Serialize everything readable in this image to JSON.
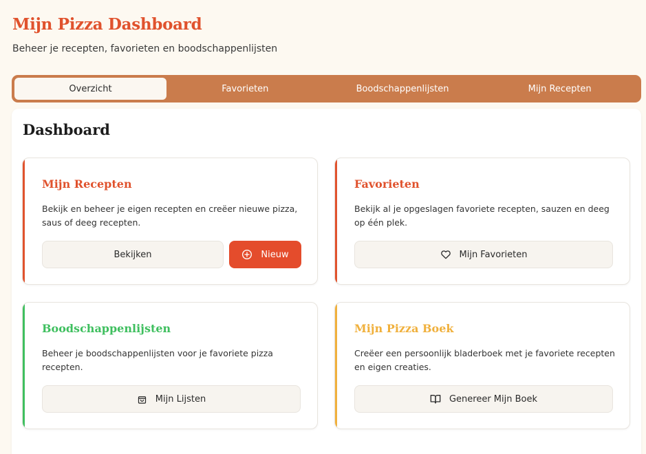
{
  "header": {
    "title": "Mijn Pizza Dashboard",
    "subtitle": "Beheer je recepten, favorieten en boodschappenlijsten"
  },
  "tabs": [
    {
      "label": "Overzicht",
      "active": true
    },
    {
      "label": "Favorieten",
      "active": false
    },
    {
      "label": "Boodschappenlijsten",
      "active": false
    },
    {
      "label": "Mijn Recepten",
      "active": false
    }
  ],
  "panel": {
    "title": "Dashboard"
  },
  "cards": {
    "recipes": {
      "title": "Mijn Recepten",
      "description": "Bekijk en beheer je eigen recepten en creëer nieuwe pizza, saus of deeg recepten.",
      "view_label": "Bekijken",
      "new_label": "Nieuw",
      "new_icon": "plus-circle-icon",
      "accent": "#e0522d"
    },
    "favorites": {
      "title": "Favorieten",
      "description": "Bekijk al je opgeslagen favoriete recepten, sauzen en deeg op één plek.",
      "button_label": "Mijn Favorieten",
      "button_icon": "heart-icon",
      "accent": "#e0522d"
    },
    "shopping": {
      "title": "Boodschappenlijsten",
      "description": "Beheer je boodschappenlijsten voor je favoriete pizza recepten.",
      "button_label": "Mijn Lijsten",
      "button_icon": "shopping-bag-icon",
      "accent": "#3fbf5f"
    },
    "book": {
      "title": "Mijn Pizza Boek",
      "description": "Creëer een persoonlijk bladerboek met je favoriete recepten en eigen creaties.",
      "button_label": "Genereer Mijn Boek",
      "button_icon": "book-open-icon",
      "accent": "#f0b03c"
    }
  }
}
